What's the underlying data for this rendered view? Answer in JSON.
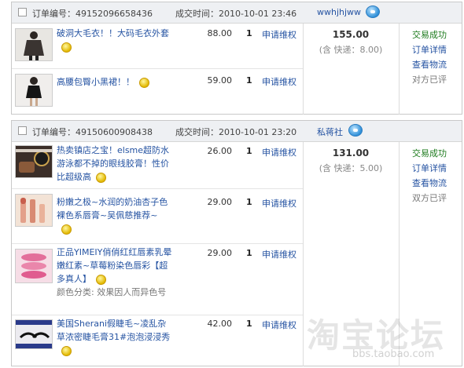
{
  "orders": [
    {
      "order_label": "订单编号：49152096658436",
      "time_label": "成交时间：2010-10-01 23:46",
      "seller": "wwhjhjww",
      "total": "155.00",
      "shipping": "(含 快递：8.00)",
      "status": "交易成功",
      "actions": [
        "订单详情",
        "查看物流"
      ],
      "review": "对方已评",
      "items": [
        {
          "title": "破洞大毛衣！！大码毛衣外套",
          "variant": "",
          "price": "88.00",
          "qty": "1",
          "rights": "申请维权"
        },
        {
          "title": "高腰包臀小黑裙！！",
          "variant": "",
          "price": "59.00",
          "qty": "1",
          "rights": "申请维权"
        }
      ]
    },
    {
      "order_label": "订单编号：49150600908438",
      "time_label": "成交时间：2010-10-01 23:20",
      "seller": "私蒋社",
      "total": "131.00",
      "shipping": "(含 快递：5.00)",
      "status": "交易成功",
      "actions": [
        "订单详情",
        "查看物流"
      ],
      "review": "双方已评",
      "items": [
        {
          "title": "热卖镇店之宝！elsme超防水游泳都不掉的眼线胶膏！性价比超级高",
          "variant": "",
          "price": "26.00",
          "qty": "1",
          "rights": "申请维权"
        },
        {
          "title": "粉嫩之极~水润的奶油杏子色裸色系唇膏~吴佩慈推荐~",
          "variant": "",
          "price": "29.00",
          "qty": "1",
          "rights": "申请维权"
        },
        {
          "title": "正品YIMEIY俏俏红红唇素乳晕嫩红素~草莓粉染色唇彩【超多真人】",
          "variant": "颜色分类: 效果因人而异色号",
          "price": "29.00",
          "qty": "1",
          "rights": "申请维权"
        },
        {
          "title": "美国Sherani假睫毛~凌乱杂草浓密睫毛膏31#泡泡浸浸秀",
          "variant": "",
          "price": "42.00",
          "qty": "1",
          "rights": "申请维权"
        }
      ]
    }
  ],
  "watermark": {
    "text": "淘宝论坛",
    "url": "bbs.taobao.com"
  },
  "colors": {
    "header_bg": "#eef0f3",
    "link": "#2553a2",
    "success": "#1e7b1e",
    "border": "#c9c9c9"
  }
}
